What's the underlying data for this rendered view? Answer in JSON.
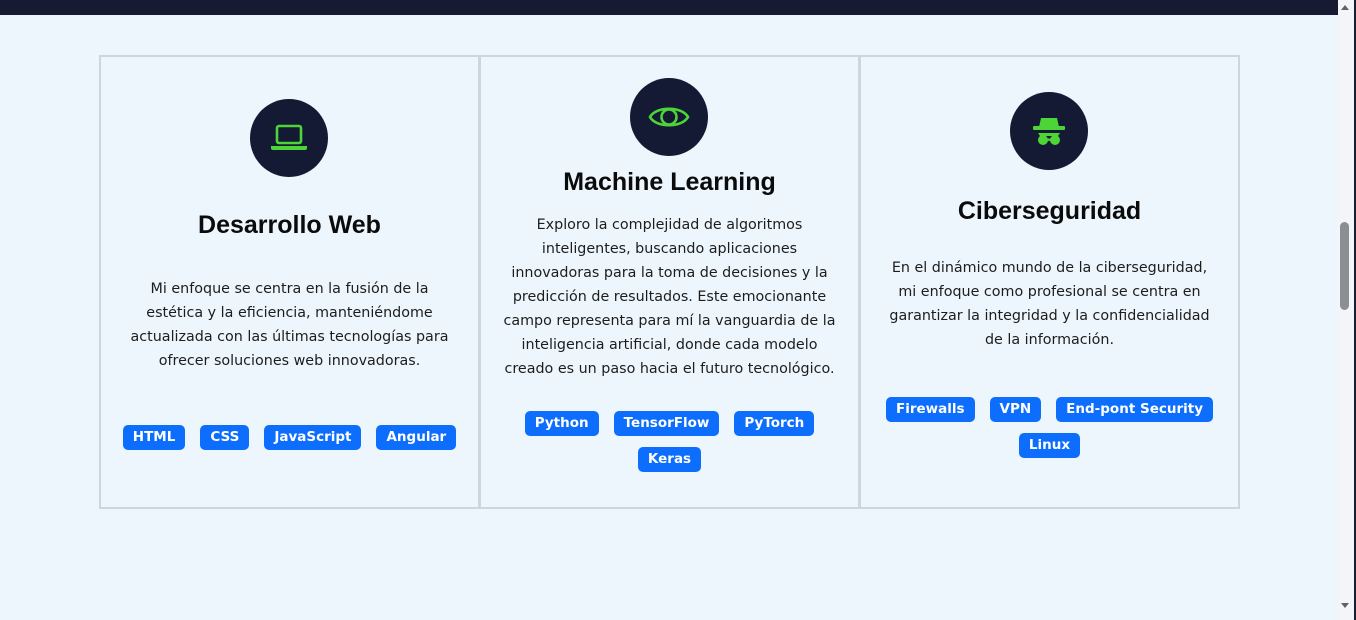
{
  "colors": {
    "background": "#edf6fd",
    "top_bar": "#161b33",
    "icon_circle": "#141a33",
    "icon_accent": "#4dd537",
    "tag": "#0d6efd",
    "card_border": "#cdd6df"
  },
  "cards": [
    {
      "icon": "laptop-icon",
      "title": "Desarrollo Web",
      "text": "Mi enfoque se centra en la fusión de la estética y la eficiencia, manteniéndome actualizada con las últimas tecnologías para ofrecer soluciones web innovadoras.",
      "tags": [
        "HTML",
        "CSS",
        "JavaScript",
        "Angular"
      ]
    },
    {
      "icon": "eye-icon",
      "title": "Machine Learning",
      "text": "Exploro la complejidad de algoritmos inteligentes, buscando aplicaciones innovadoras para la toma de decisiones y la predicción de resultados. Este emocionante campo representa para mí la vanguardia de la inteligencia artificial, donde cada modelo creado es un paso hacia el futuro tecnológico.",
      "tags": [
        "Python",
        "TensorFlow",
        "PyTorch",
        "Keras"
      ]
    },
    {
      "icon": "user-secret-icon",
      "title": "Ciberseguridad",
      "text": "En el dinámico mundo de la ciberseguridad, mi enfoque como profesional se centra en garantizar la integridad y la confidencialidad de la información.",
      "tags": [
        "Firewalls",
        "VPN",
        "End-pont Security",
        "Linux"
      ]
    }
  ]
}
